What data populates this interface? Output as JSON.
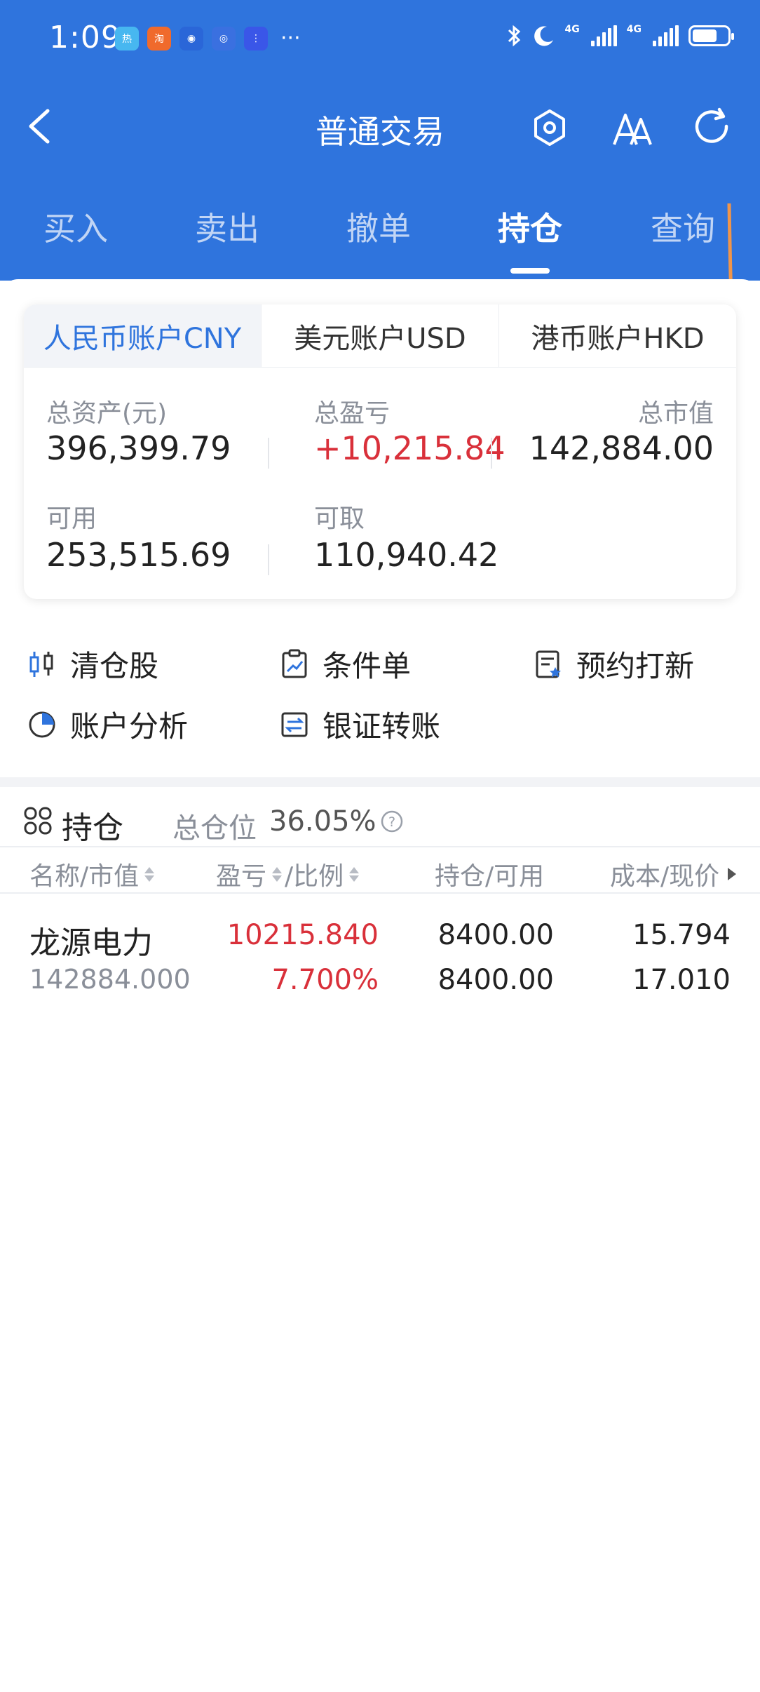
{
  "status_bar": {
    "time": "1:09",
    "apps": [
      {
        "icon": "app-1-icon",
        "color": "#47b7f0",
        "label": "热"
      },
      {
        "icon": "taobao-icon",
        "color": "#f06a2c",
        "label": "淘"
      },
      {
        "icon": "app-3-icon",
        "color": "#2a66d8",
        "label": "◉"
      },
      {
        "icon": "browser-icon",
        "color": "#3a70e0",
        "label": "◎"
      },
      {
        "icon": "voice-icon",
        "color": "#3a56e8",
        "label": "⋮"
      }
    ],
    "more": "···",
    "network1": "4G",
    "network2": "4G"
  },
  "nav": {
    "title": "普通交易"
  },
  "trade_tabs": [
    {
      "label": "买入",
      "active": false
    },
    {
      "label": "卖出",
      "active": false
    },
    {
      "label": "撤单",
      "active": false
    },
    {
      "label": "持仓",
      "active": true
    },
    {
      "label": "查询",
      "active": false
    }
  ],
  "currency_tabs": [
    {
      "label": "人民币账户CNY",
      "active": true
    },
    {
      "label": "美元账户USD",
      "active": false
    },
    {
      "label": "港币账户HKD",
      "active": false
    }
  ],
  "account": {
    "total_assets_label": "总资产(元)",
    "total_assets": "396,399.79",
    "total_pnl_label": "总盈亏",
    "total_pnl": "+10,215.84",
    "market_value_label": "总市值",
    "market_value": "142,884.00",
    "available_label": "可用",
    "available": "253,515.69",
    "withdrawable_label": "可取",
    "withdrawable": "110,940.42"
  },
  "quick_actions": [
    {
      "label": "清仓股",
      "icon": "candlestick-icon"
    },
    {
      "label": "条件单",
      "icon": "clipboard-chart-icon"
    },
    {
      "label": "预约打新",
      "icon": "document-star-icon"
    },
    {
      "label": "账户分析",
      "icon": "pie-chart-icon"
    },
    {
      "label": "银证转账",
      "icon": "transfer-icon"
    }
  ],
  "positions": {
    "title": "持仓",
    "ratio_label": "总仓位",
    "ratio_value": "36.05%",
    "columns": [
      "名称/市值",
      "盈亏",
      "/比例",
      "持仓/可用",
      "成本/现价"
    ],
    "rows": [
      {
        "name": "龙源电力",
        "market_value": "142884.000",
        "pnl": "10215.840",
        "pnl_ratio": "7.700%",
        "holding": "8400.00",
        "available": "8400.00",
        "cost": "15.794",
        "price": "17.010"
      }
    ]
  },
  "colors": {
    "header_blue": "#2f74dd",
    "profit_red": "#d9303a",
    "scroll_marker_orange": "#f0954a"
  }
}
